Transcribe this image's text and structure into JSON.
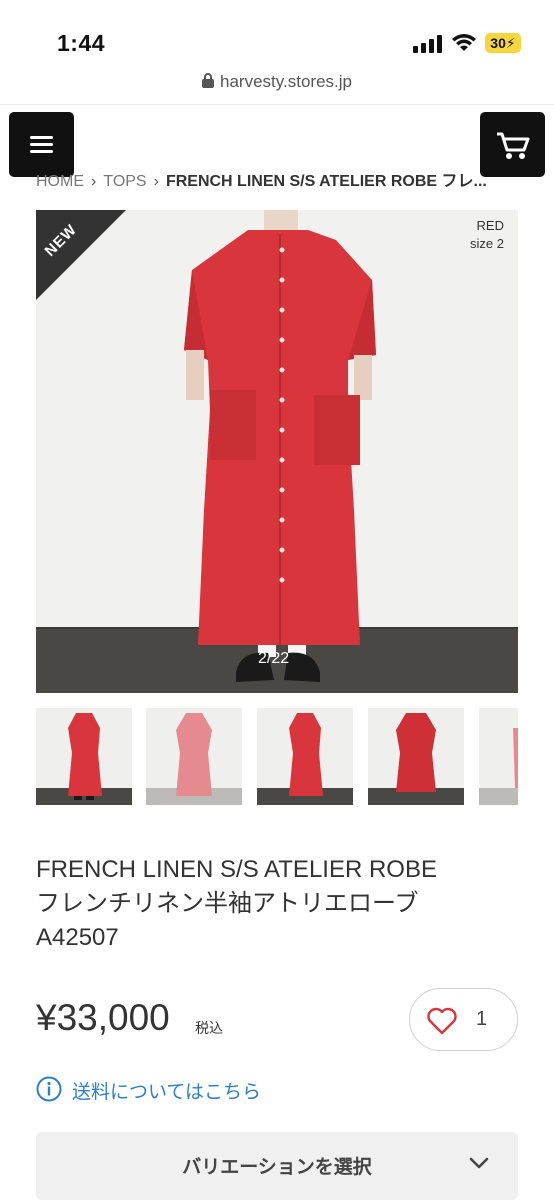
{
  "status": {
    "time": "1:44",
    "battery": "30"
  },
  "browser": {
    "url": "harvesty.stores.jp"
  },
  "breadcrumb": {
    "home": "HOME",
    "category": "TOPS",
    "current": "FRENCH LINEN S/S ATELIER ROBE フレ..."
  },
  "gallery": {
    "badge": "NEW",
    "color": "RED",
    "size": "size 2",
    "counter": "2/22"
  },
  "product": {
    "title_en": "FRENCH LINEN S/S ATELIER ROBE",
    "title_ja": "フレンチリネン半袖アトリエローブ",
    "code": "A42507",
    "price": "¥33,000",
    "tax_note": "税込",
    "likes": "1"
  },
  "shipping": {
    "link_text": "送料についてはこちら"
  },
  "variation": {
    "label": "バリエーションを選択"
  },
  "colors": {
    "dress": "#d8363c",
    "ribbon": "#333333",
    "link": "#2f7fc3"
  }
}
